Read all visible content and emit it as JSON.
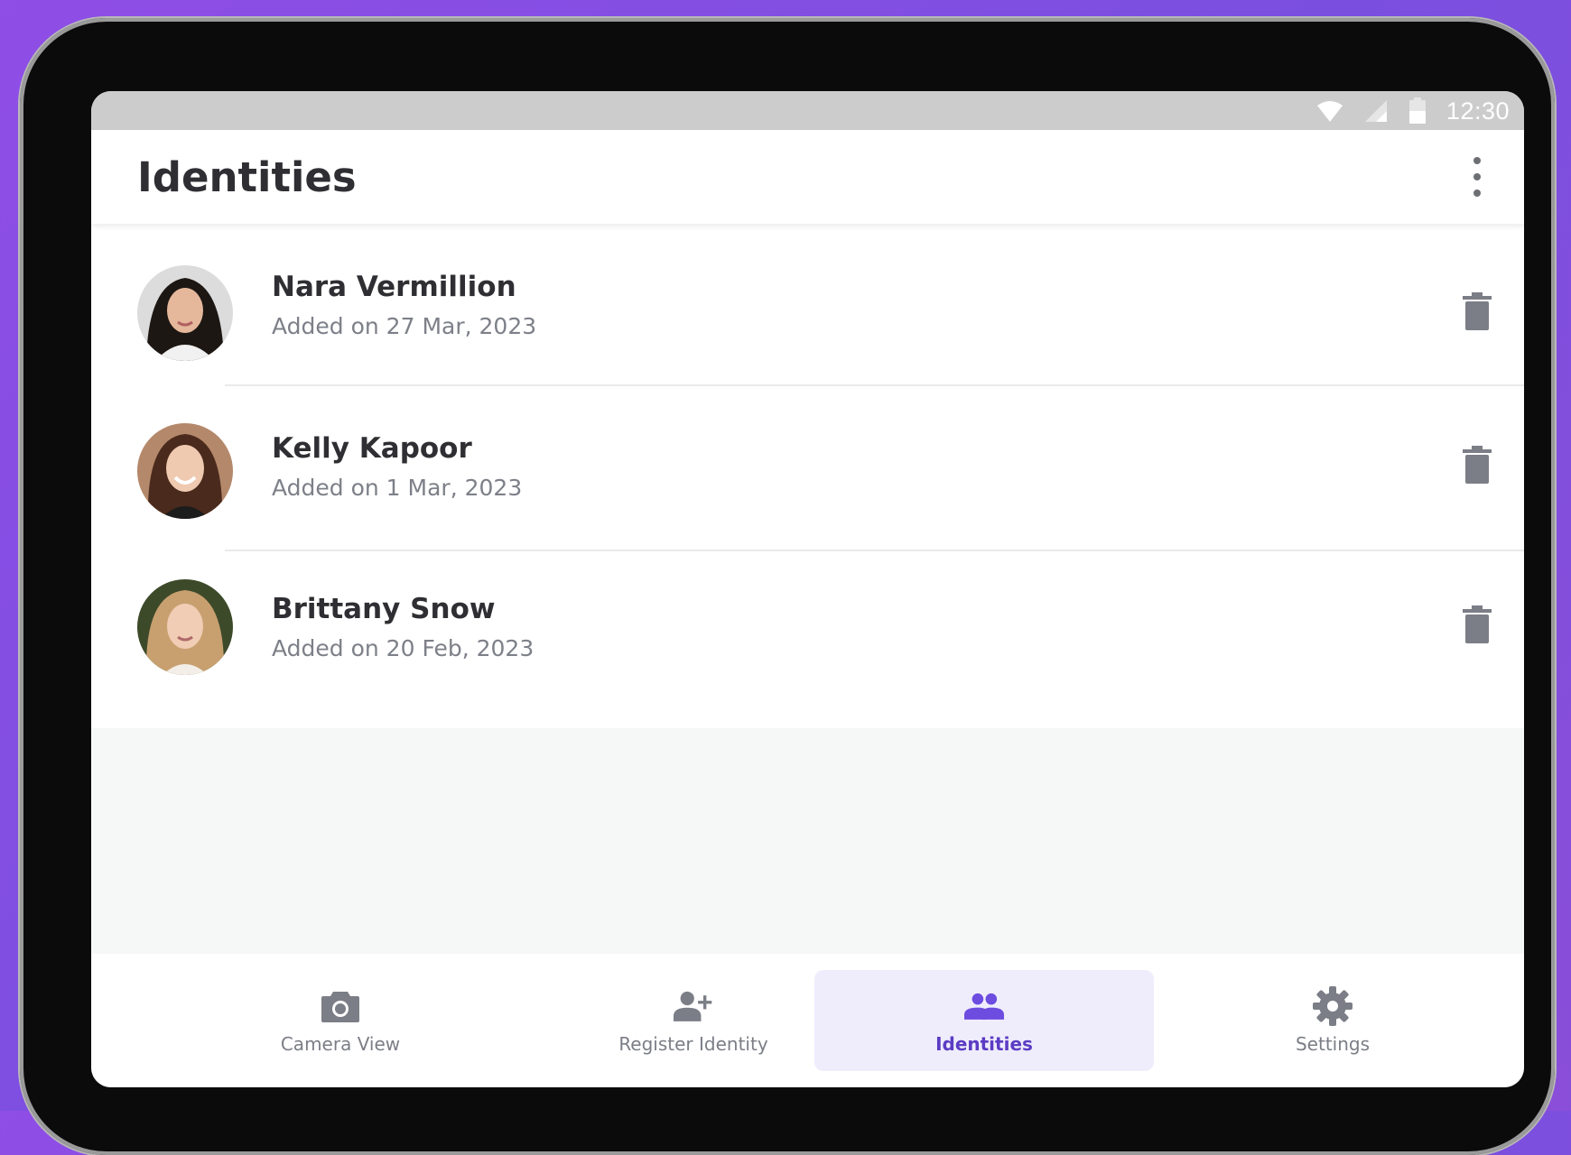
{
  "status_bar": {
    "time": "12:30"
  },
  "header": {
    "title": "Identities"
  },
  "identities": [
    {
      "name": "Nara Vermillion",
      "added": "Added on 27 Mar, 2023"
    },
    {
      "name": "Kelly Kapoor",
      "added": "Added on 1 Mar, 2023"
    },
    {
      "name": "Brittany Snow",
      "added": "Added on 20 Feb, 2023"
    }
  ],
  "nav": {
    "items": [
      {
        "label": "Camera View",
        "icon": "camera-icon"
      },
      {
        "label": "Register Identity",
        "icon": "person-add-icon"
      },
      {
        "label": "Identities",
        "icon": "people-icon",
        "active": true
      },
      {
        "label": "Settings",
        "icon": "gear-icon"
      }
    ]
  },
  "colors": {
    "accent": "#6d4ce0",
    "active_nav_bg": "#efedfc",
    "icon_gray": "#6d6f75"
  }
}
